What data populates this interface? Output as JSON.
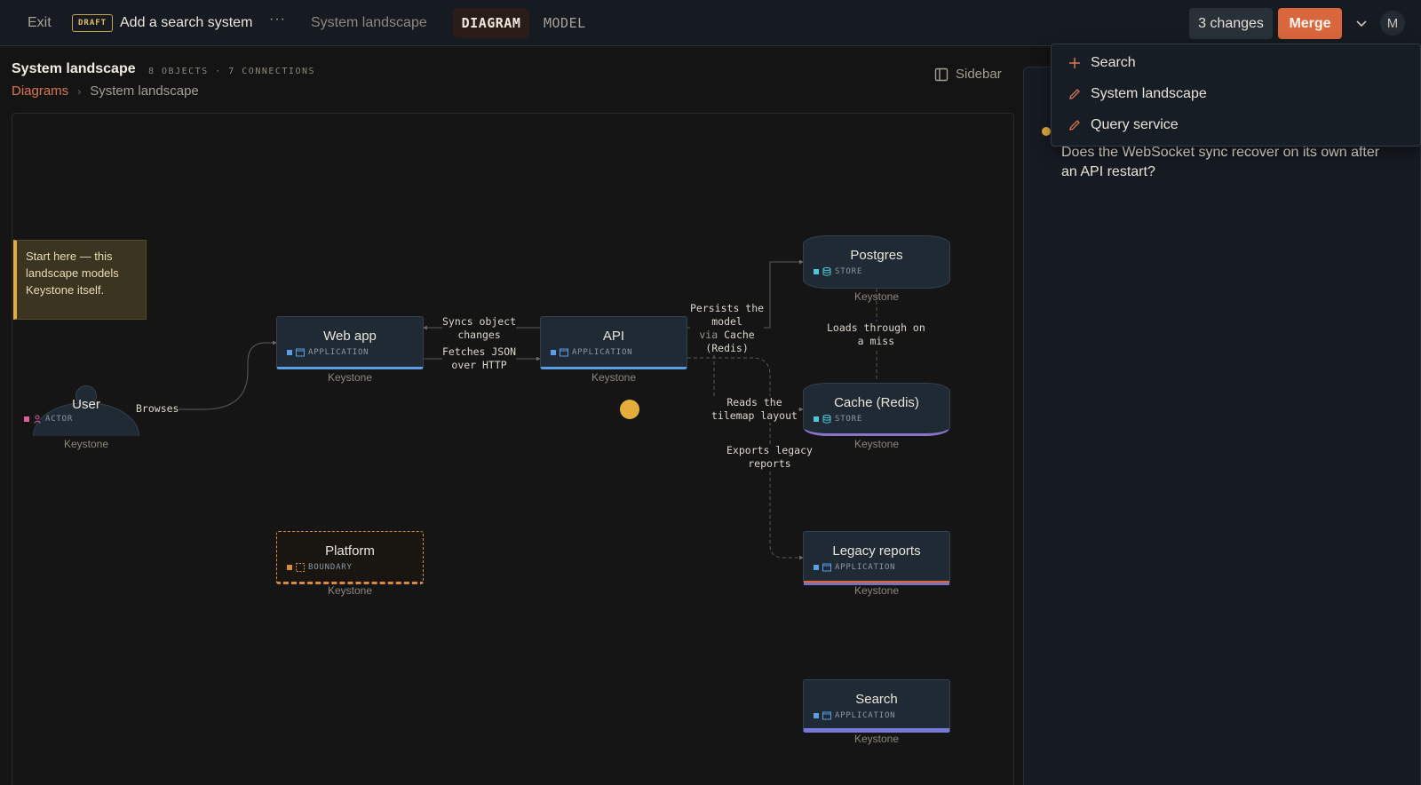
{
  "topbar": {
    "exit_label": "Exit",
    "draft_badge": "DRAFT",
    "branch_title": "Add a search system",
    "more_label": "···",
    "diagram_crumb": "System landscape",
    "tabs": [
      {
        "label": "DIAGRAM",
        "active": true
      },
      {
        "label": "MODEL",
        "active": false
      }
    ],
    "changes_label": "3 changes",
    "merge_label": "Merge",
    "avatar_initial": "M",
    "accent_color": "#d9663c"
  },
  "header": {
    "title": "System landscape",
    "stats": "8 OBJECTS · 7 CONNECTIONS",
    "breadcrumb": {
      "root": "Diagrams",
      "current": "System landscape"
    },
    "sidebar_label": "Sidebar"
  },
  "canvas": {
    "note": "Start here — this landscape models Keystone itself.",
    "nodes": {
      "user": {
        "title": "User",
        "kind": "ACTOR",
        "system": "Keystone",
        "icon": "person-icon"
      },
      "webapp": {
        "title": "Web app",
        "kind": "APPLICATION",
        "system": "Keystone",
        "icon": "window-icon"
      },
      "api": {
        "title": "API",
        "kind": "APPLICATION",
        "system": "Keystone",
        "icon": "window-icon"
      },
      "postgres": {
        "title": "Postgres",
        "kind": "STORE",
        "system": "Keystone",
        "icon": "database-icon"
      },
      "cache": {
        "title": "Cache (Redis)",
        "kind": "STORE",
        "system": "Keystone",
        "icon": "database-icon"
      },
      "legacy": {
        "title": "Legacy reports",
        "kind": "APPLICATION",
        "system": "Keystone",
        "icon": "window-icon"
      },
      "platform": {
        "title": "Platform",
        "kind": "BOUNDARY",
        "system": "Keystone",
        "icon": "boundary-icon"
      },
      "search": {
        "title": "Search",
        "kind": "APPLICATION",
        "system": "Keystone",
        "icon": "window-icon"
      }
    },
    "edges": {
      "browses": "Browses",
      "syncs": [
        "Syncs object",
        "changes"
      ],
      "fetches": [
        "Fetches JSON",
        "over HTTP"
      ],
      "persists": [
        "Persists the",
        "model"
      ],
      "persists_via_prefix": "via",
      "persists_via_target": "Cache",
      "persists_via_paren": "(Redis)",
      "loads": [
        "Loads through on",
        "a miss"
      ],
      "reads": [
        "Reads the",
        "tilemap layout"
      ],
      "exports": [
        "Exports legacy",
        "reports"
      ]
    }
  },
  "sidepanel": {
    "comment": "Does the WebSocket sync recover on its own after an API restart?"
  },
  "dropdown": {
    "items": [
      {
        "label": "Search",
        "icon": "plus-icon"
      },
      {
        "label": "System landscape",
        "icon": "pencil-icon"
      },
      {
        "label": "Query service",
        "icon": "pencil-icon"
      }
    ]
  }
}
